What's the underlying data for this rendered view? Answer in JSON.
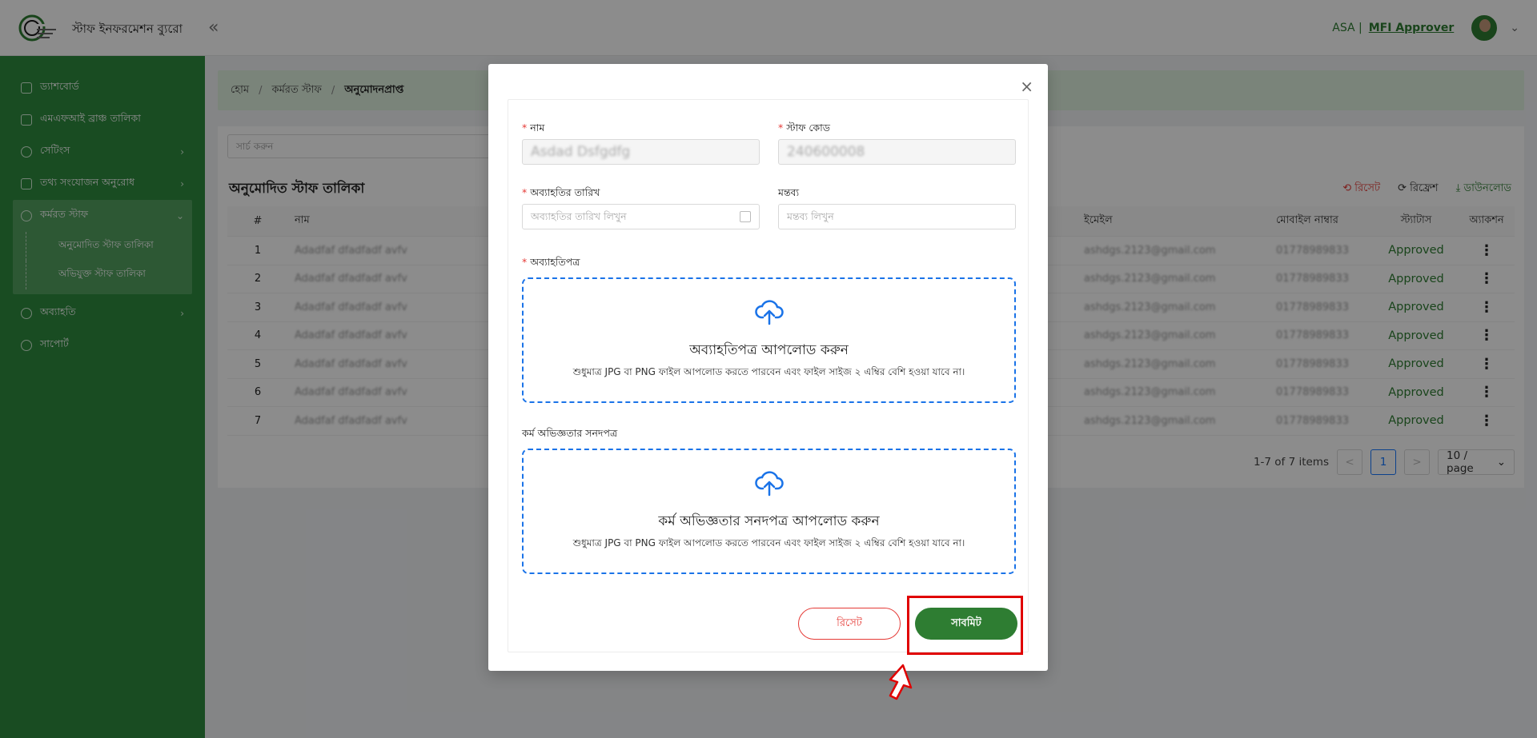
{
  "header": {
    "brand": "স্টাফ ইনফরমেশন ব্যুরো",
    "collapse_icon": "«",
    "org": "ASA |",
    "role": "MFI Approver",
    "chevron": "⌄"
  },
  "sidebar": {
    "items": [
      {
        "label": "ড্যাশবোর্ড"
      },
      {
        "label": "এমএফআই ব্রাঞ্চ তালিকা"
      },
      {
        "label": "সেটিংস"
      },
      {
        "label": "তথ্য সংযোজন অনুরোধ"
      },
      {
        "label": "কর্মরত স্টাফ"
      },
      {
        "label": "অব্যাহতি"
      },
      {
        "label": "সাপোর্ট"
      }
    ],
    "sub_items": [
      {
        "label": "অনুমোদিত স্টাফ তালিকা"
      },
      {
        "label": "অভিযুক্ত স্টাফ তালিকা"
      }
    ]
  },
  "breadcrumb": {
    "home": "হোম",
    "parent": "কর্মরত স্টাফ",
    "current": "অনুমোদনপ্রাপ্ত",
    "sep": "/"
  },
  "main": {
    "search_placeholder": "সার্চ করুন",
    "title": "অনুমোদিত স্টাফ তালিকা",
    "toolbar": {
      "reset": "রিসেট",
      "refresh": "রিফ্রেশ",
      "download": "ডাউনলোড"
    },
    "columns": {
      "num": "#",
      "name": "নাম",
      "email": "ইমেইল",
      "mobile": "মোবাইল নাম্বার",
      "status": "স্ট্যাটাস",
      "action": "অ্যাকশন"
    },
    "rows": [
      {
        "num": "1",
        "name": "Adadfaf dfadfadf avfv",
        "email": "ashdgs.2123@gmail.com",
        "mobile": "01778989833",
        "status": "Approved",
        "action": "⋮"
      },
      {
        "num": "2",
        "name": "Adadfaf dfadfadf avfv",
        "email": "ashdgs.2123@gmail.com",
        "mobile": "01778989833",
        "status": "Approved",
        "action": "⋮"
      },
      {
        "num": "3",
        "name": "Adadfaf dfadfadf avfv",
        "email": "ashdgs.2123@gmail.com",
        "mobile": "01778989833",
        "status": "Approved",
        "action": "⋮"
      },
      {
        "num": "4",
        "name": "Adadfaf dfadfadf avfv",
        "email": "ashdgs.2123@gmail.com",
        "mobile": "01778989833",
        "status": "Approved",
        "action": "⋮"
      },
      {
        "num": "5",
        "name": "Adadfaf dfadfadf avfv",
        "email": "ashdgs.2123@gmail.com",
        "mobile": "01778989833",
        "status": "Approved",
        "action": "⋮"
      },
      {
        "num": "6",
        "name": "Adadfaf dfadfadf avfv",
        "email": "ashdgs.2123@gmail.com",
        "mobile": "01778989833",
        "status": "Approved",
        "action": "⋮"
      },
      {
        "num": "7",
        "name": "Adadfaf dfadfadf avfv",
        "email": "ashdgs.2123@gmail.com",
        "mobile": "01778989833",
        "status": "Approved",
        "action": "⋮"
      }
    ],
    "pagination": {
      "summary": "1-7 of 7 items",
      "prev": "<",
      "page": "1",
      "next": ">",
      "page_size": "10 / page",
      "size_chevron": "⌄"
    }
  },
  "modal": {
    "close": "×",
    "name_label": "নাম",
    "name_value": "Asdad Dsfgdfg",
    "staff_code_label": "স্টাফ কোড",
    "staff_code_value": "240600008",
    "release_date_label": "অব্যাহতির তারিখ",
    "release_date_placeholder": "অব্যাহতির তারিখ লিখুন",
    "comment_label": "মন্তব্য",
    "comment_placeholder": "মন্তব্য লিখুন",
    "release_letter_label": "অব্যাহতিপত্র",
    "release_upload_title": "অব্যাহতিপত্র আপলোড করুন",
    "upload_hint": "শুধুমাত্র JPG বা PNG ফাইল আপলোড করতে পারবেন এবং ফাইল সাইজ ২ এম্বির বেশি হওয়া যাবে না।",
    "experience_label": "কর্ম অভিজ্ঞতার সনদপত্র",
    "experience_upload_title": "কর্ম অভিজ্ঞতার সনদপত্র আপলোড করুন",
    "reset_button": "রিসেট",
    "submit_button": "সাবমিট",
    "required_mark": "*"
  },
  "colors": {
    "brand_green": "#2e8b3e",
    "accent_green": "#2e7d32",
    "danger": "#e53935",
    "upload_blue": "#1a73e8",
    "highlight_red": "#e00000"
  }
}
